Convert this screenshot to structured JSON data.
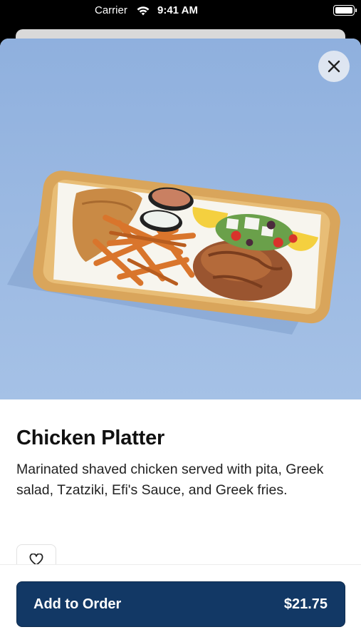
{
  "status_bar": {
    "carrier": "Carrier",
    "time": "9:41 AM"
  },
  "item": {
    "title": "Chicken Platter",
    "description": "Marinated shaved chicken served with pita, Greek salad, Tzatziki, Efi's Sauce, and Greek fries."
  },
  "order_button": {
    "label": "Add to Order",
    "price": "$21.75"
  },
  "colors": {
    "primary": "#123865",
    "hero_bg": "#9bb9e2"
  },
  "icons": {
    "close": "close-icon",
    "favorite": "heart-icon",
    "wifi": "wifi-icon",
    "battery": "battery-icon"
  }
}
